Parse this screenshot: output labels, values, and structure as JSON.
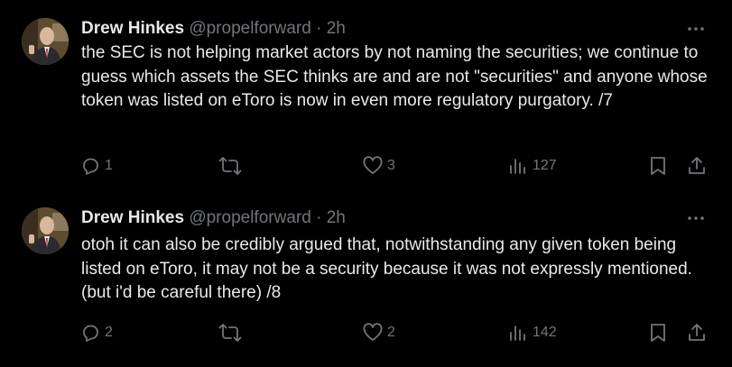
{
  "tweets": [
    {
      "author": "Drew Hinkes",
      "handle": "@propelforward",
      "separator": "·",
      "time": "2h",
      "text": "the SEC is not helping market actors by not naming the securities; we continue to guess which assets the SEC thinks are and are not \"securities\" and anyone whose token was listed on eToro is now in even more regulatory purgatory. /7",
      "replies": "1",
      "retweets": "",
      "likes": "3",
      "views": "127"
    },
    {
      "author": "Drew Hinkes",
      "handle": "@propelforward",
      "separator": "·",
      "time": "2h",
      "text": "otoh it can also be credibly argued that, notwithstanding any given token being listed on eToro, it may not be a security because it was not expressly mentioned. (but i'd be careful there) /8",
      "replies": "2",
      "retweets": "",
      "likes": "2",
      "views": "142"
    }
  ],
  "icons": {
    "more": "more-horizontal-icon",
    "reply": "reply-icon",
    "retweet": "retweet-icon",
    "like": "heart-icon",
    "views": "analytics-icon",
    "bookmark": "bookmark-icon",
    "share": "share-icon"
  },
  "colors": {
    "background": "#000000",
    "primary_text": "#e7e9ea",
    "secondary_text": "#71767b"
  }
}
